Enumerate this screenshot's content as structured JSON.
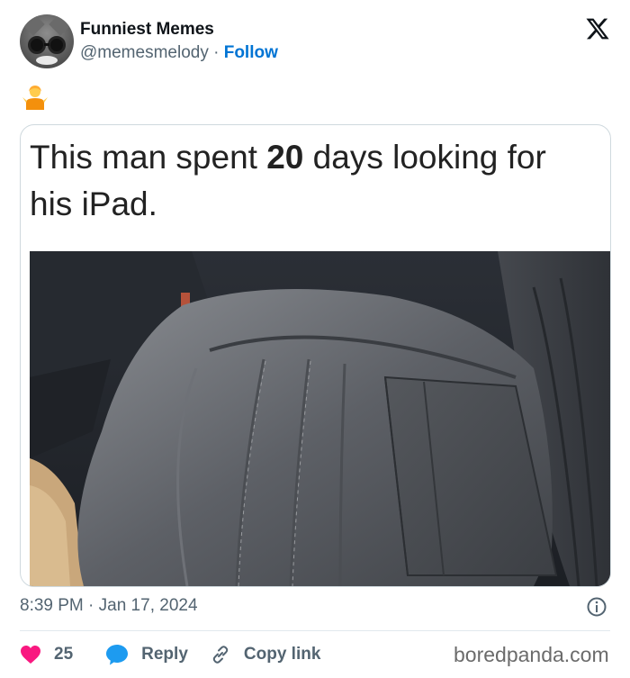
{
  "author": {
    "display_name": "Funniest Memes",
    "handle": "@memesmelody",
    "separator": " · ",
    "follow_label": "Follow"
  },
  "tweet": {
    "emoji": "🤷",
    "meme_text_before": "This man spent ",
    "meme_text_bold": "20",
    "meme_text_after": " days looking for his iPad.",
    "timestamp": "8:39 PM · Jan 17, 2024"
  },
  "actions": {
    "like_count": "25",
    "reply_label": "Reply",
    "copy_link_label": "Copy link"
  },
  "watermark": "boredpanda.com",
  "colors": {
    "follow": "#0074d4",
    "like": "#f91880",
    "reply": "#1d9bf0",
    "muted_text": "#536471"
  }
}
